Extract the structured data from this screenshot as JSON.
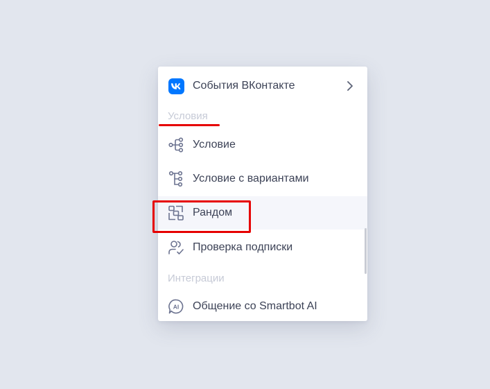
{
  "menu": {
    "vk_item": {
      "label": "События ВКонтакте",
      "icon": "vk-logo-icon"
    },
    "sections": {
      "conditions": "Условия",
      "integrations": "Интеграции"
    },
    "items": [
      {
        "label": "Условие",
        "icon": "branch-icon"
      },
      {
        "label": "Условие с вариантами",
        "icon": "tree-branch-icon"
      },
      {
        "label": "Рандом",
        "icon": "random-icon",
        "hovered": true
      },
      {
        "label": "Проверка подписки",
        "icon": "user-check-icon"
      },
      {
        "label": "Общение со Smartbot AI",
        "icon": "ai-chat-icon"
      }
    ]
  },
  "colors": {
    "background": "#e2e6ee",
    "vk_brand": "#0077ff",
    "annotation_red": "#e60000",
    "icon_stroke": "#6c7390",
    "text": "#3c4256",
    "section_text": "#c6cad6"
  }
}
